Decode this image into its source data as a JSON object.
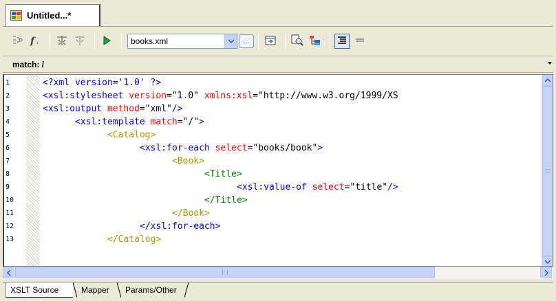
{
  "document": {
    "title": "Untitled...*"
  },
  "toolbar": {
    "source_file": "books.xml",
    "source_options": [
      "books.xml"
    ]
  },
  "matchbar": {
    "label": "match: /"
  },
  "editor": {
    "line_numbers": [
      "1",
      "2",
      "3",
      "4",
      "5",
      "6",
      "7",
      "8",
      "9",
      "10",
      "11",
      "12",
      "13"
    ],
    "lines": [
      {
        "indent": 0,
        "parts": [
          [
            "c-pi",
            "<?xml version='1.0' ?>"
          ]
        ]
      },
      {
        "indent": 0,
        "parts": [
          [
            "c-xsl",
            "<xsl:stylesheet "
          ],
          [
            "c-attr",
            "version"
          ],
          [
            "c-val",
            "=\"1.0\" "
          ],
          [
            "c-attr",
            "xmlns:xsl"
          ],
          [
            "c-val",
            "=\"http://www.w3.org/1999/XS"
          ]
        ]
      },
      {
        "indent": 0,
        "parts": [
          [
            "c-xsl",
            "<xsl:output "
          ],
          [
            "c-attr",
            "method"
          ],
          [
            "c-val",
            "=\"xml\""
          ],
          [
            "c-xsl",
            "/>"
          ]
        ]
      },
      {
        "indent": 1,
        "parts": [
          [
            "c-xsl",
            "<xsl:template "
          ],
          [
            "c-attr",
            "match"
          ],
          [
            "c-val",
            "=\"/\""
          ],
          [
            "c-xsl",
            ">"
          ]
        ]
      },
      {
        "indent": 2,
        "parts": [
          [
            "c-lit",
            "<Catalog>"
          ]
        ]
      },
      {
        "indent": 3,
        "parts": [
          [
            "c-xsl",
            "<xsl:for-each "
          ],
          [
            "c-attr",
            "select"
          ],
          [
            "c-val",
            "=\"books/book\""
          ],
          [
            "c-xsl",
            ">"
          ]
        ]
      },
      {
        "indent": 4,
        "parts": [
          [
            "c-lit",
            "<Book>"
          ]
        ]
      },
      {
        "indent": 5,
        "parts": [
          [
            "c-lit2",
            "<Title>"
          ]
        ]
      },
      {
        "indent": 6,
        "parts": [
          [
            "c-xsl",
            "<xsl:value-of "
          ],
          [
            "c-attr",
            "select"
          ],
          [
            "c-val",
            "=\"title\""
          ],
          [
            "c-xsl",
            "/>"
          ]
        ]
      },
      {
        "indent": 5,
        "parts": [
          [
            "c-lit2",
            "</Title>"
          ]
        ]
      },
      {
        "indent": 4,
        "parts": [
          [
            "c-lit",
            "</Book>"
          ]
        ]
      },
      {
        "indent": 3,
        "parts": [
          [
            "c-xsl",
            "</xsl:for-each>"
          ]
        ]
      },
      {
        "indent": 2,
        "parts": [
          [
            "c-lit",
            "</Catalog>"
          ]
        ]
      }
    ]
  },
  "bottom_tabs": [
    {
      "label": "XSLT Source",
      "active": true
    },
    {
      "label": "Mapper",
      "active": false
    },
    {
      "label": "Params/Other",
      "active": false
    }
  ],
  "icons": {
    "doc": "xslt-document-icon",
    "toolbar": [
      "xpath-tree-icon",
      "function-icon",
      "debug-icon",
      "step-icon",
      "run-icon",
      "combo-browse-icon",
      "open-output-icon",
      "find-icon",
      "tree-view-icon",
      "indent-icon",
      "line-icon"
    ]
  },
  "colors": {
    "element": "#0000ff",
    "attribute": "#ff0000",
    "literal_tag": "#a0a000",
    "literal_child": "#008000"
  }
}
